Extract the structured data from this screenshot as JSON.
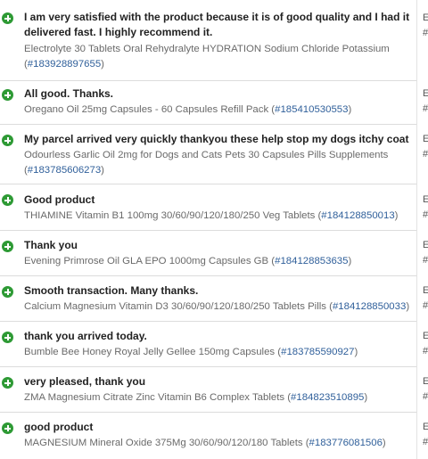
{
  "reviews": [
    {
      "comment": "I am very satisfied with the product because it is of good quality and I had it delivered fast. I highly recommend it.",
      "product": "Electrolyte 30 Tablets Oral Rehydralyte HYDRATION Sodium Chloride Potassium",
      "order": "183928897655",
      "icon": "plus-circle-icon",
      "edge": [
        "E",
        "#"
      ]
    },
    {
      "comment": "All good. Thanks.",
      "product": "Oregano Oil 25mg Capsules - 60 Capsules Refill Pack",
      "order": "185410530553",
      "icon": "plus-circle-icon",
      "edge": [
        "E",
        "#"
      ]
    },
    {
      "comment": "My parcel arrived very quickly thankyou these help stop my dogs itchy coat",
      "product": "Odourless Garlic Oil 2mg for Dogs and Cats Pets 30 Capsules Pills Supplements",
      "order": "183785606273",
      "icon": "plus-circle-icon",
      "edge": [
        "E",
        "#"
      ]
    },
    {
      "comment": "Good product",
      "product": "THIAMINE Vitamin B1 100mg 30/60/90/120/180/250 Veg Tablets",
      "order": "184128850013",
      "icon": "plus-circle-icon",
      "edge": [
        "E",
        "#"
      ]
    },
    {
      "comment": "Thank you",
      "product": "Evening Primrose Oil GLA EPO 1000mg Capsules GB",
      "order": "184128853635",
      "icon": "plus-circle-icon",
      "edge": [
        "E",
        "#"
      ]
    },
    {
      "comment": "Smooth transaction. Many thanks.",
      "product": "Calcium Magnesium Vitamin D3 30/60/90/120/180/250 Tablets Pills",
      "order": "184128850033",
      "icon": "plus-circle-icon",
      "edge": [
        "E",
        "#"
      ]
    },
    {
      "comment": "thank you arrived today.",
      "product": "Bumble Bee Honey Royal Jelly Gellee 150mg Capsules",
      "order": "183785590927",
      "icon": "plus-circle-icon",
      "edge": [
        "E",
        "#"
      ]
    },
    {
      "comment": "very pleased, thank you",
      "product": "ZMA Magnesium Citrate Zinc Vitamin B6 Complex Tablets",
      "order": "184823510895",
      "icon": "plus-circle-icon",
      "edge": [
        "E",
        "#"
      ]
    },
    {
      "comment": "good product",
      "product": "MAGNESIUM Mineral Oxide 375Mg 30/60/90/120/180 Tablets",
      "order": "183776081506",
      "icon": "plus-circle-icon",
      "edge": [
        "E",
        "#"
      ]
    }
  ],
  "colors": {
    "positive": "#2e9a35",
    "order_link": "#2f5f9a"
  }
}
